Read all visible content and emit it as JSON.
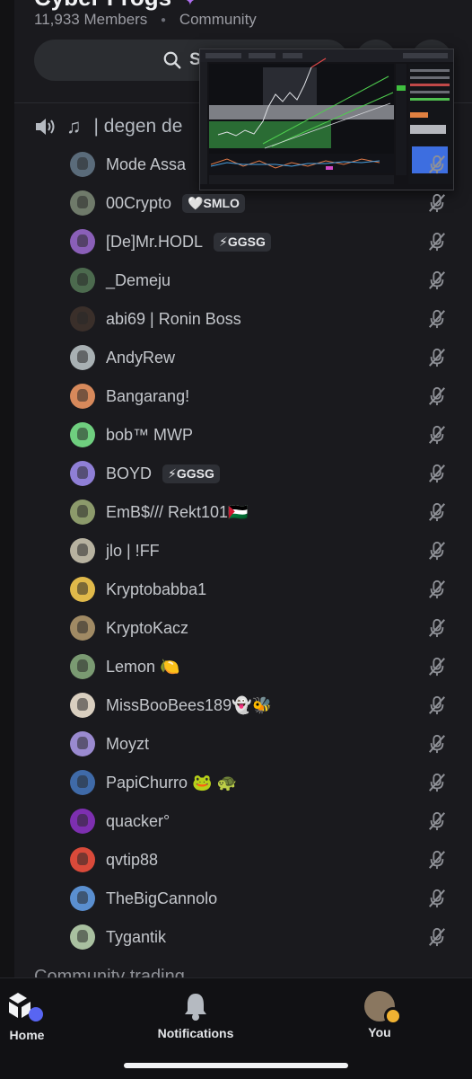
{
  "server": {
    "name": "Cyber Frogs",
    "members": "11,933 Members",
    "type": "Community"
  },
  "search": {
    "label": "Sea"
  },
  "voice_channel": {
    "name": "| degen de",
    "next_channel": "Community trading"
  },
  "users": [
    {
      "name": "Mode Assa",
      "color": "#5a6b7a"
    },
    {
      "name": "00Crypto",
      "tag": "🤍SMLO",
      "color": "#6f7a6a"
    },
    {
      "name": "[De]Mr.HODL",
      "tag": "⚡GGSG",
      "color": "#8a5fb8"
    },
    {
      "name": "_Demeju",
      "color": "#4c6a4e"
    },
    {
      "name": "abi69 | Ronin Boss",
      "color": "#3a2f2a"
    },
    {
      "name": "AndyRew",
      "color": "#a8b0b3"
    },
    {
      "name": "Bangarang!",
      "color": "#d7895b"
    },
    {
      "name": "bob™ MWP",
      "color": "#6fcf7f"
    },
    {
      "name": "BOYD",
      "tag": "⚡GGSG",
      "color": "#8f7fd6"
    },
    {
      "name": "EmB$/// Rekt101🇵🇸",
      "color": "#8c9a6b"
    },
    {
      "name": "jlo | !FF",
      "color": "#b7b2a0"
    },
    {
      "name": "Kryptobabba1",
      "color": "#e0b94a"
    },
    {
      "name": "KryptoKacz",
      "color": "#a08a64"
    },
    {
      "name": "Lemon 🍋",
      "color": "#7a9a72"
    },
    {
      "name": "MissBooBees189👻🐝",
      "color": "#d9cfc0"
    },
    {
      "name": "Moyzt",
      "color": "#9a8ad0"
    },
    {
      "name": "PapiChurro 🐸 🐢",
      "color": "#3f6aa8"
    },
    {
      "name": "quacker°",
      "color": "#7d2fb0"
    },
    {
      "name": "qvtip88",
      "color": "#d94a3a"
    },
    {
      "name": "TheBigCannolo",
      "color": "#5a8fd0"
    },
    {
      "name": "Tygantik",
      "color": "#a9c0a0"
    }
  ],
  "nav": {
    "home": "Home",
    "notifications": "Notifications",
    "you": "You"
  },
  "colors": {
    "accent": "#5865f2",
    "background": "#1a1a1e",
    "boost": "#b06ff0"
  }
}
